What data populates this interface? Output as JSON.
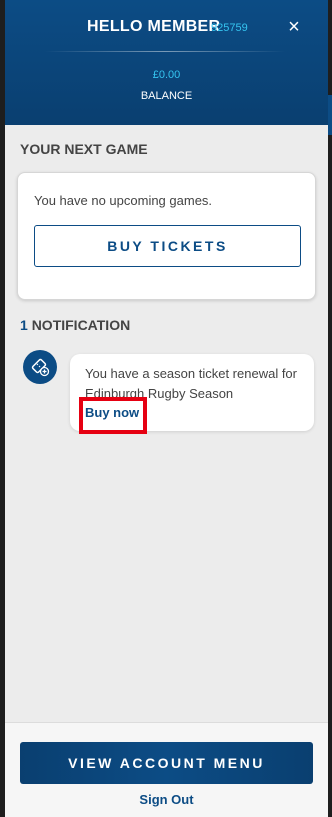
{
  "header": {
    "greeting": "HELLO MEMBER",
    "member_id": "925759",
    "close_glyph": "×",
    "balance_amount": "£0.00",
    "balance_label": "BALANCE"
  },
  "next_game": {
    "title": "YOUR NEXT GAME",
    "empty_text": "You have no upcoming games.",
    "buy_tickets_label": "BUY TICKETS"
  },
  "notifications": {
    "count": "1",
    "title": "NOTIFICATION",
    "icon": "ticket-add-icon",
    "items": [
      {
        "text": "You have a season ticket renewal for Edinburgh Rugby Season",
        "action_label": "Buy now"
      }
    ]
  },
  "footer": {
    "account_menu_label": "VIEW ACCOUNT MENU",
    "sign_out_label": "Sign Out"
  },
  "colors": {
    "brand_navy": "#0c4c85",
    "accent_cyan": "#35c4f0",
    "highlight_red": "#e60012"
  }
}
